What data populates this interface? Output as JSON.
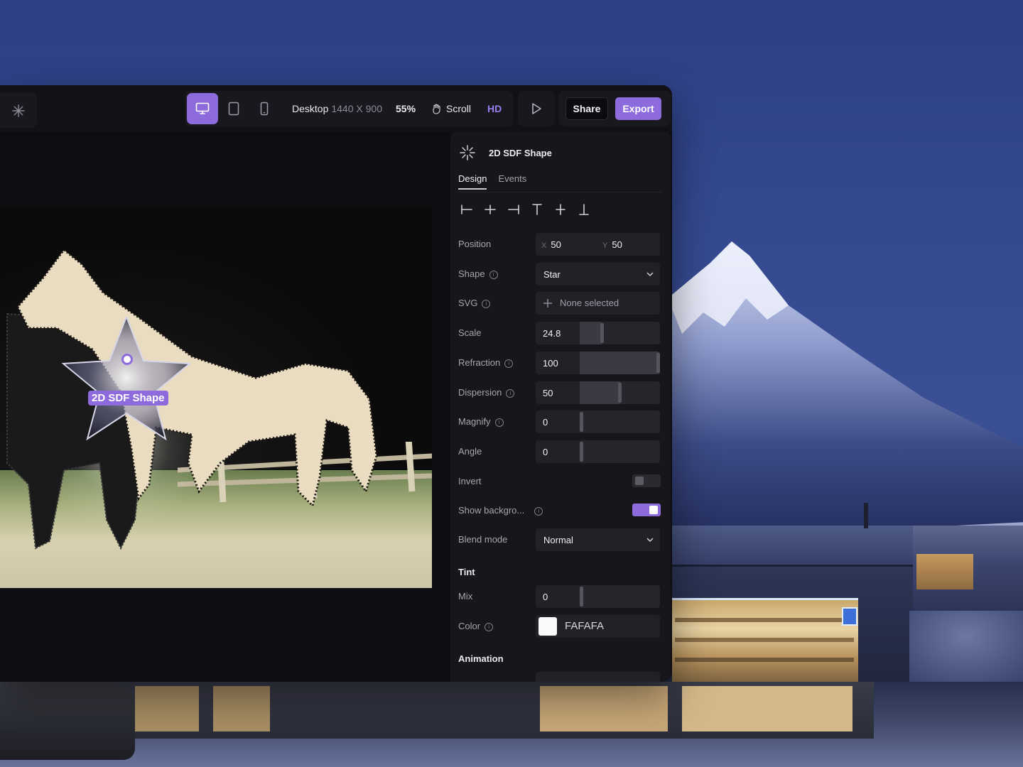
{
  "toolbar": {
    "device_label": "Desktop",
    "device_size": "1440 X 900",
    "zoom": "55%",
    "scroll_label": "Scroll",
    "hd_label": "HD",
    "share_label": "Share",
    "export_label": "Export",
    "active_device": "desktop",
    "icons": [
      "sparkle-icon",
      "desktop-icon",
      "tablet-icon",
      "phone-icon",
      "hand-icon",
      "play-icon"
    ]
  },
  "canvas": {
    "element_tag": "2D SDF Shape"
  },
  "panel": {
    "title": "2D SDF Shape",
    "tabs": [
      {
        "label": "Design",
        "active": true
      },
      {
        "label": "Events",
        "active": false
      }
    ],
    "position": {
      "label": "Position",
      "x_axis": "X",
      "x": "50",
      "y_axis": "Y",
      "y": "50"
    },
    "shape": {
      "label": "Shape",
      "value": "Star"
    },
    "svg": {
      "label": "SVG",
      "value": "None selected"
    },
    "scale": {
      "label": "Scale",
      "value": "24.8",
      "fraction": 0.27
    },
    "refraction": {
      "label": "Refraction",
      "value": "100",
      "fraction": 1.0
    },
    "dispersion": {
      "label": "Dispersion",
      "value": "50",
      "fraction": 0.5
    },
    "magnify": {
      "label": "Magnify",
      "value": "0",
      "fraction": 0.0
    },
    "angle": {
      "label": "Angle",
      "value": "0",
      "fraction": 0.0
    },
    "invert": {
      "label": "Invert",
      "on": false
    },
    "show_background": {
      "label": "Show backgro...",
      "on": true
    },
    "blend_mode": {
      "label": "Blend mode",
      "value": "Normal"
    },
    "tint": {
      "title": "Tint",
      "mix": {
        "label": "Mix",
        "value": "0",
        "fraction": 0.0
      },
      "color": {
        "label": "Color",
        "hex": "FAFAFA",
        "swatch": "#fafafa"
      }
    },
    "animation_title": "Animation"
  },
  "colors": {
    "accent": "#8e6bdc",
    "panel_bg": "#16161b",
    "field_bg": "#212127"
  }
}
